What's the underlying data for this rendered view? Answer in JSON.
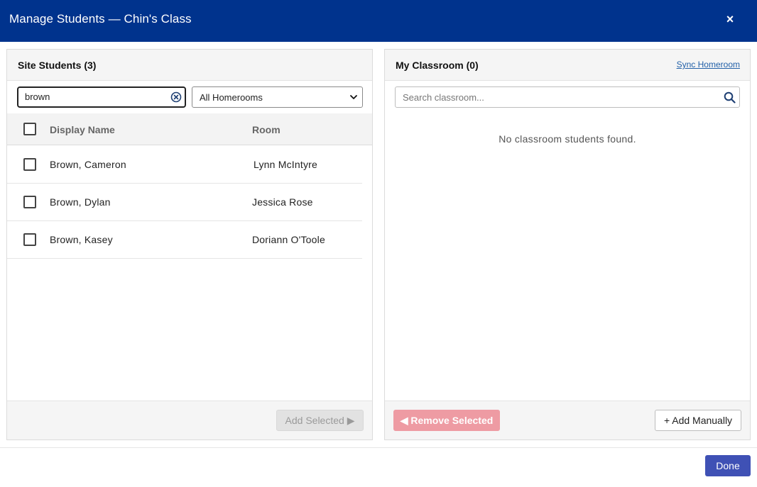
{
  "modal": {
    "title": "Manage Students — Chin's Class",
    "close_icon": "×"
  },
  "site_students": {
    "title": "Site Students (3)",
    "search_value": "brown",
    "homeroom_filter": "All Homerooms",
    "columns": {
      "name": "Display Name",
      "room": "Room"
    },
    "rows": [
      {
        "name": "Brown, Cameron",
        "room": "Lynn McIntyre"
      },
      {
        "name": "Brown, Dylan",
        "room": "Jessica Rose"
      },
      {
        "name": "Brown, Kasey",
        "room": "Doriann O'Toole"
      }
    ],
    "add_selected_label": "Add Selected ▶"
  },
  "my_classroom": {
    "title": "My Classroom (0)",
    "sync_link": "Sync Homeroom",
    "search_placeholder": "Search classroom...",
    "empty_message": "No classroom students found.",
    "remove_selected_label": "◀ Remove Selected",
    "add_manually_label": "+ Add Manually"
  },
  "footer": {
    "done_label": "Done"
  },
  "colors": {
    "header": "#00338d",
    "done": "#3f51b5",
    "remove": "#ee9ba3",
    "link": "#2260a8"
  },
  "icons": [
    "close-icon",
    "clear-search-icon",
    "chevron-down-icon",
    "search-icon"
  ]
}
